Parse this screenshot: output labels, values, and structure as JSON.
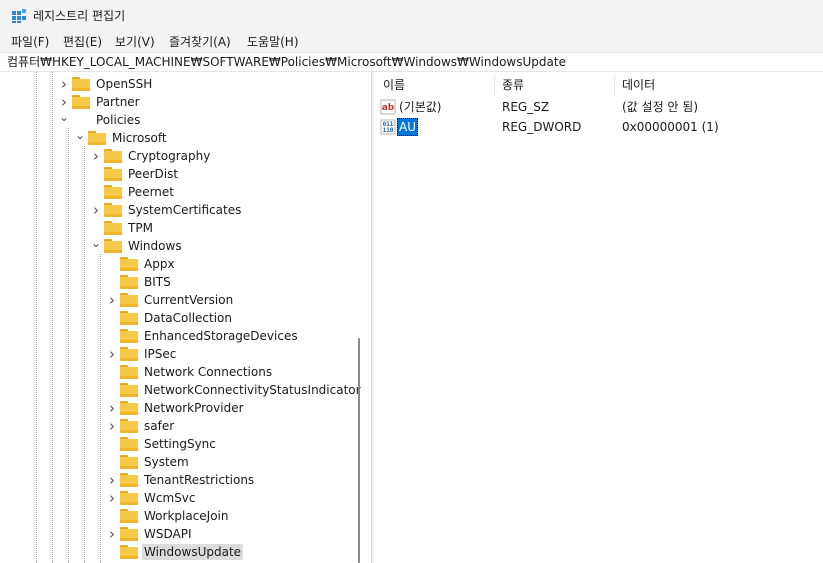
{
  "window": {
    "title": "레지스트리 편집기"
  },
  "menu": [
    "파일(F)",
    "편집(E)",
    "보기(V)",
    "즐겨찾기(A)",
    "도움말(H)"
  ],
  "address": "컴퓨터₩HKEY_LOCAL_MACHINE₩SOFTWARE₩Policies₩Microsoft₩Windows₩WindowsUpdate",
  "tree": [
    {
      "label": "OpenSSH",
      "expander": "collapsed"
    },
    {
      "label": "Partner",
      "expander": "collapsed"
    },
    {
      "label": "Policies",
      "expander": "expanded",
      "icon": "none"
    },
    {
      "label": "Microsoft",
      "expander": "expanded"
    },
    {
      "label": "Cryptography",
      "expander": "collapsed"
    },
    {
      "label": "PeerDist",
      "expander": "none"
    },
    {
      "label": "Peernet",
      "expander": "none"
    },
    {
      "label": "SystemCertificates",
      "expander": "collapsed"
    },
    {
      "label": "TPM",
      "expander": "none"
    },
    {
      "label": "Windows",
      "expander": "expanded"
    },
    {
      "label": "Appx",
      "expander": "none"
    },
    {
      "label": "BITS",
      "expander": "none"
    },
    {
      "label": "CurrentVersion",
      "expander": "collapsed"
    },
    {
      "label": "DataCollection",
      "expander": "none"
    },
    {
      "label": "EnhancedStorageDevices",
      "expander": "none"
    },
    {
      "label": "IPSec",
      "expander": "collapsed"
    },
    {
      "label": "Network Connections",
      "expander": "none"
    },
    {
      "label": "NetworkConnectivityStatusIndicator",
      "expander": "none"
    },
    {
      "label": "NetworkProvider",
      "expander": "collapsed"
    },
    {
      "label": "safer",
      "expander": "collapsed"
    },
    {
      "label": "SettingSync",
      "expander": "none"
    },
    {
      "label": "System",
      "expander": "none"
    },
    {
      "label": "TenantRestrictions",
      "expander": "collapsed"
    },
    {
      "label": "WcmSvc",
      "expander": "collapsed"
    },
    {
      "label": "WorkplaceJoin",
      "expander": "none"
    },
    {
      "label": "WSDAPI",
      "expander": "collapsed"
    },
    {
      "label": "WindowsUpdate",
      "expander": "none",
      "selected": true
    }
  ],
  "columns": {
    "name": "이름",
    "type": "종류",
    "data": "데이터"
  },
  "values": [
    {
      "name": "(기본값)",
      "type": "REG_SZ",
      "data": "(값 설정 안 됨)",
      "icon": "string-value-icon"
    },
    {
      "name": "AU",
      "type": "REG_DWORD",
      "data": "0x00000001 (1)",
      "icon": "binary-value-icon",
      "selected": true
    }
  ]
}
